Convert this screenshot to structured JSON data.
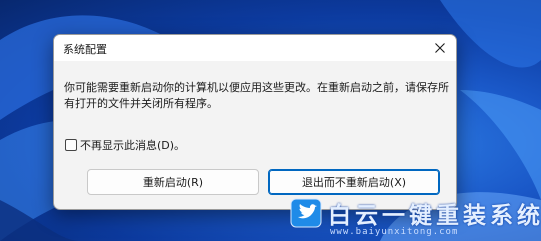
{
  "dialog": {
    "title": "系统配置",
    "message": "你可能需要重新启动你的计算机以便应用这些更改。在重新启动之前，请保存所有打开的文件并关闭所有程序。",
    "checkbox_label": "不再显示此消息(D)。",
    "checkbox_checked": false,
    "buttons": {
      "restart": "重新启动(R)",
      "exit_without_restart": "退出而不重新启动(X)"
    }
  },
  "watermark": {
    "name": "白云一键重装系统",
    "url": "www.baiyunxitong.com"
  },
  "colors": {
    "accent": "#0067c0",
    "wallpaper": "#1a58c8"
  },
  "icons": {
    "close": "close-icon",
    "watermark_logo": "bird-logo-icon"
  }
}
